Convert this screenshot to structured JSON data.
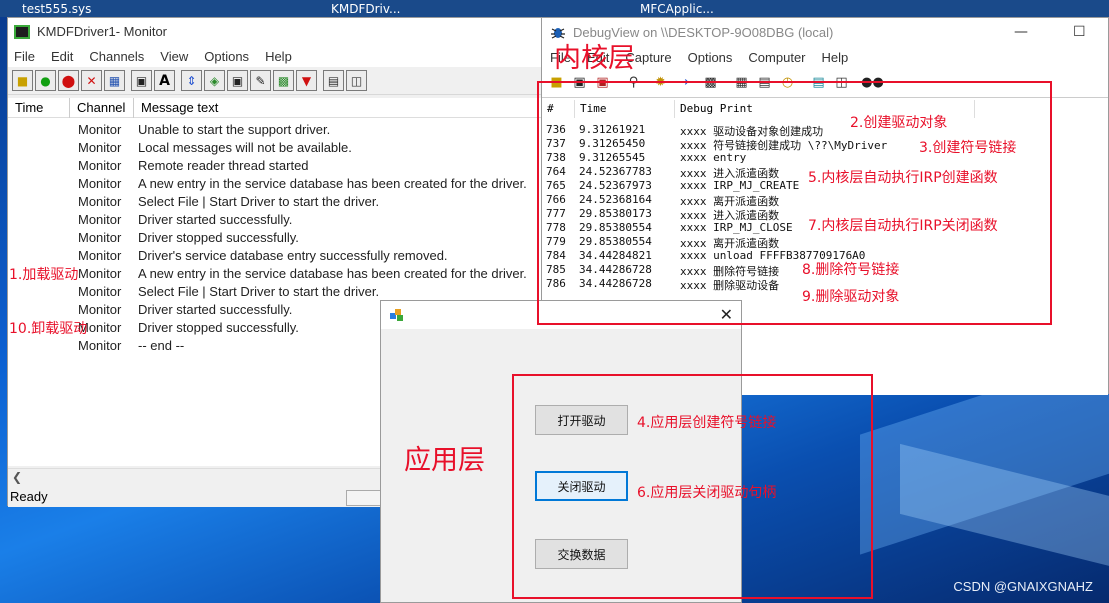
{
  "taskbar_labels": [
    "test555.sys",
    "KMDFDriv...",
    "MFCApplic..."
  ],
  "monitor": {
    "title": "KMDFDriver1- Monitor",
    "menu": [
      "File",
      "Edit",
      "Channels",
      "View",
      "Options",
      "Help"
    ],
    "columns": [
      "Time",
      "Channel",
      "Message text"
    ],
    "rows": [
      {
        "channel": "Monitor",
        "message": "Unable to start the support driver."
      },
      {
        "channel": "Monitor",
        "message": "Local messages will not be available."
      },
      {
        "channel": "Monitor",
        "message": "Remote reader thread started"
      },
      {
        "channel": "Monitor",
        "message": "A new entry in the service database has been created for the driver."
      },
      {
        "channel": "Monitor",
        "message": "Select File | Start Driver to start the driver."
      },
      {
        "channel": "Monitor",
        "message": "Driver started successfully."
      },
      {
        "channel": "Monitor",
        "message": "Driver stopped successfully."
      },
      {
        "channel": "Monitor",
        "message": "Driver's service database entry successfully removed."
      },
      {
        "channel": "Monitor",
        "message": "A new entry in the service database has been created for the driver."
      },
      {
        "channel": "Monitor",
        "message": "Select File | Start Driver to start the driver."
      },
      {
        "channel": "Monitor",
        "message": "Driver started successfully."
      },
      {
        "channel": "Monitor",
        "message": "Driver stopped successfully."
      },
      {
        "channel": "Monitor",
        "message": " -- end --"
      }
    ],
    "status": "Ready"
  },
  "debugview": {
    "title": "DebugView on \\\\DESKTOP-9O08DBG (local)",
    "menu": [
      "File",
      "Edit",
      "Capture",
      "Options",
      "Computer",
      "Help"
    ],
    "columns": [
      "#",
      "Time",
      "Debug Print"
    ],
    "rows": [
      {
        "n": "736",
        "time": "9.31261921",
        "text": "xxxx 驱动设备对象创建成功"
      },
      {
        "n": "737",
        "time": "9.31265450",
        "text": "xxxx 符号链接创建成功 \\??\\MyDriver"
      },
      {
        "n": "738",
        "time": "9.31265545",
        "text": "xxxx entry"
      },
      {
        "n": "764",
        "time": "24.52367783",
        "text": "xxxx 进入派遣函数"
      },
      {
        "n": "765",
        "time": "24.52367973",
        "text": "xxxx IRP_MJ_CREATE"
      },
      {
        "n": "766",
        "time": "24.52368164",
        "text": "xxxx 离开派遣函数"
      },
      {
        "n": "777",
        "time": "29.85380173",
        "text": "xxxx 进入派遣函数"
      },
      {
        "n": "778",
        "time": "29.85380554",
        "text": "xxxx IRP_MJ_CLOSE"
      },
      {
        "n": "779",
        "time": "29.85380554",
        "text": "xxxx 离开派遣函数"
      },
      {
        "n": "784",
        "time": "34.44284821",
        "text": "xxxx unload  FFFFB387709176A0"
      },
      {
        "n": "785",
        "time": "34.44286728",
        "text": "xxxx 删除符号链接"
      },
      {
        "n": "786",
        "time": "34.44286728",
        "text": "xxxx 删除驱动设备"
      }
    ]
  },
  "dialog": {
    "open_label": "打开驱动",
    "close_label": "关闭驱动",
    "exchange_label": "交换数据"
  },
  "annotations": {
    "kernel_layer": "内核层",
    "app_layer": "应用层",
    "n1": "1.加载驱动",
    "n2": "2.创建驱动对象",
    "n3": "3.创建符号链接",
    "n4": "4.应用层创建符号链接",
    "n5": "5.内核层自动执行IRP创建函数",
    "n6": "6.应用层关闭驱动句柄",
    "n7": "7.内核层自动执行IRP关闭函数",
    "n8": "8.删除符号链接",
    "n9": "9.删除驱动对象",
    "n10": "10.卸载驱动"
  },
  "watermark": "CSDN @GNAIXGNAHZ",
  "colors": {
    "annotation_red": "#e8102a",
    "focus_blue": "#0078d7",
    "desktop_blue": "#0b5fd0"
  }
}
